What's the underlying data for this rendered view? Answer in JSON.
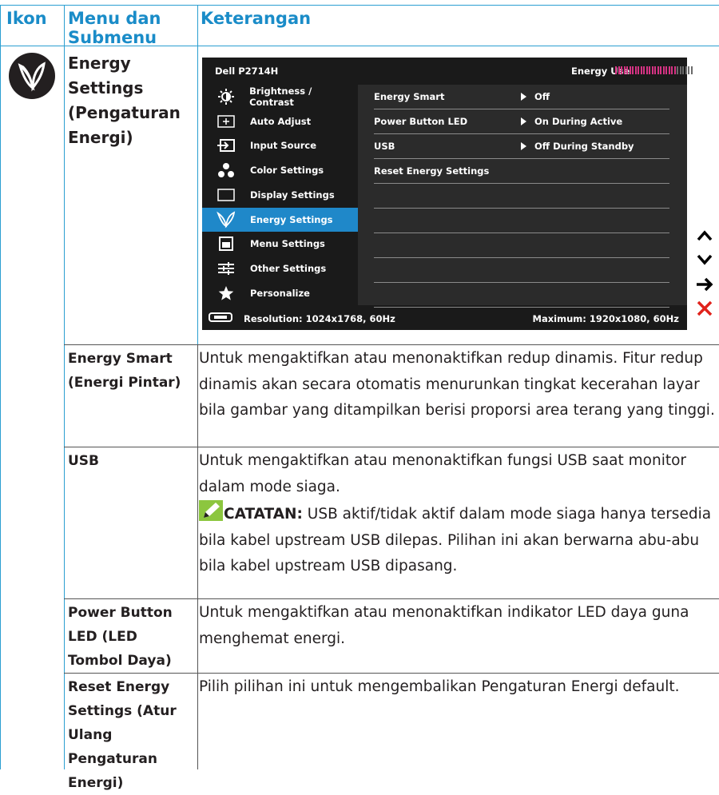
{
  "header": {
    "icon_col": "Ikon",
    "menu_col": "Menu dan Submenu",
    "desc_col": "Keterangan"
  },
  "energy_row": {
    "name": "Energy Settings (Pengaturan Energi)"
  },
  "osd": {
    "model": "Dell P2714H",
    "energy_use_label": "Energy Use",
    "energy_use_level": 0.78,
    "menu": [
      {
        "label": "Brightness / Contrast",
        "icon": "brightness-icon"
      },
      {
        "label": "Auto Adjust",
        "icon": "auto-adjust-icon"
      },
      {
        "label": "Input Source",
        "icon": "input-source-icon"
      },
      {
        "label": "Color Settings",
        "icon": "color-settings-icon"
      },
      {
        "label": "Display Settings",
        "icon": "display-settings-icon"
      },
      {
        "label": "Energy Settings",
        "icon": "leaf-icon",
        "selected": true
      },
      {
        "label": "Menu Settings",
        "icon": "menu-settings-icon"
      },
      {
        "label": "Other Settings",
        "icon": "other-settings-icon"
      },
      {
        "label": "Personalize",
        "icon": "star-icon"
      }
    ],
    "submenu": [
      {
        "label": "Energy Smart",
        "value": "Off"
      },
      {
        "label": "Power Button LED",
        "value": "On During Active"
      },
      {
        "label": "USB",
        "value": "Off During Standby"
      },
      {
        "label": "Reset Energy Settings",
        "value": ""
      }
    ],
    "resolution": "Resolution: 1024x1768, 60Hz",
    "maximum": "Maximum: 1920x1080, 60Hz"
  },
  "side_buttons": [
    "up-arrow-icon",
    "down-arrow-icon",
    "right-arrow-icon",
    "close-x-icon"
  ],
  "rows": [
    {
      "name": "Energy Smart (Energi Pintar)",
      "desc": "Untuk mengaktifkan atau menonaktifkan redup dinamis. Fitur redup dinamis akan secara otomatis menurunkan tingkat kecerahan layar bila gambar yang ditampilkan berisi proporsi area terang yang tinggi."
    },
    {
      "name": "USB",
      "desc": "Untuk mengaktifkan atau menonaktifkan fungsi USB saat monitor dalam mode siaga.",
      "note_label": "CATATAN:",
      "note_text": " USB aktif/tidak aktif dalam mode siaga hanya tersedia bila kabel upstream USB dilepas. Pilihan ini akan berwarna abu-abu bila kabel upstream USB dipasang."
    },
    {
      "name": "Power Button LED (LED Tombol Daya)",
      "desc": "Untuk mengaktifkan atau menonaktifkan indikator LED daya guna menghemat energi."
    },
    {
      "name": "Reset Energy Settings (Atur Ulang Pengaturan Energi)",
      "desc": "Pilih pilihan ini untuk mengembalikan Pengaturan Energi default."
    }
  ],
  "colors": {
    "accent": "#2b9fd1",
    "header_text": "#1a8cc8",
    "osd_select": "#1f88c9",
    "energy_bar": "#d63384"
  }
}
